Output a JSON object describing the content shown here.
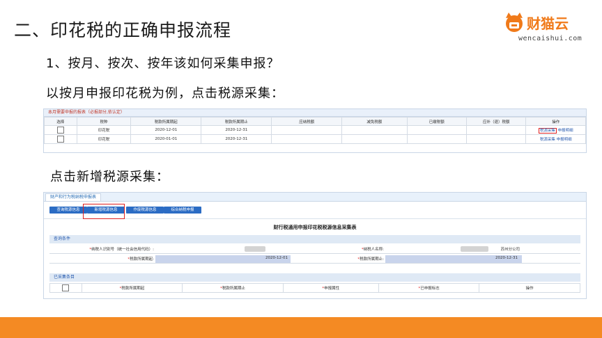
{
  "slide": {
    "title": "二、印花税的正确申报流程",
    "question": "1、按月、按次、按年该如何采集申报？",
    "example": "以按月申报印花税为例，点击税源采集：",
    "step2": "点击新增税源采集："
  },
  "logo": {
    "name": "财猫云",
    "url": "wencaishui.com"
  },
  "table1": {
    "header": "本月需要申报的报表（必报部分,依认定）",
    "columns": [
      "选择",
      "税种",
      "税款所属期起",
      "税款所属期止",
      "应纳税额",
      "减免税额",
      "已缴税额",
      "应补（退）税额",
      "操作"
    ],
    "rows": [
      {
        "tax": "印花税",
        "start": "2020-12-01",
        "end": "2020-12-31",
        "action1": "税源采集",
        "action2": "申报明细"
      },
      {
        "tax": "印花税",
        "start": "2020-01-01",
        "end": "2020-12-31",
        "action1": "税源采集",
        "action2": "申报明细"
      }
    ]
  },
  "form": {
    "tab": "财产和行为税纳税申报表",
    "buttons": [
      "查询税源信息",
      "新增税源信息",
      "作废税源信息",
      "综合纳税申报"
    ],
    "title": "财行税通用申报印花税税源信息采集表",
    "query_section": "查询条件",
    "taxpayer_id_label": "纳税人识别号（统一社会信用代码）:",
    "taxpayer_name_label": "纳税人名称:",
    "taxpayer_name_suffix": "苏州分公司",
    "period_start_label": "税款所属期起:",
    "period_start": "2020-12-01",
    "period_end_label": "税款所属期止:",
    "period_end": "2020-12-31",
    "collected_section": "已采集条目",
    "collected_columns": [
      "税款所属期起",
      "税款所属期止",
      "申报属性",
      "已申报标志",
      "操作"
    ]
  }
}
